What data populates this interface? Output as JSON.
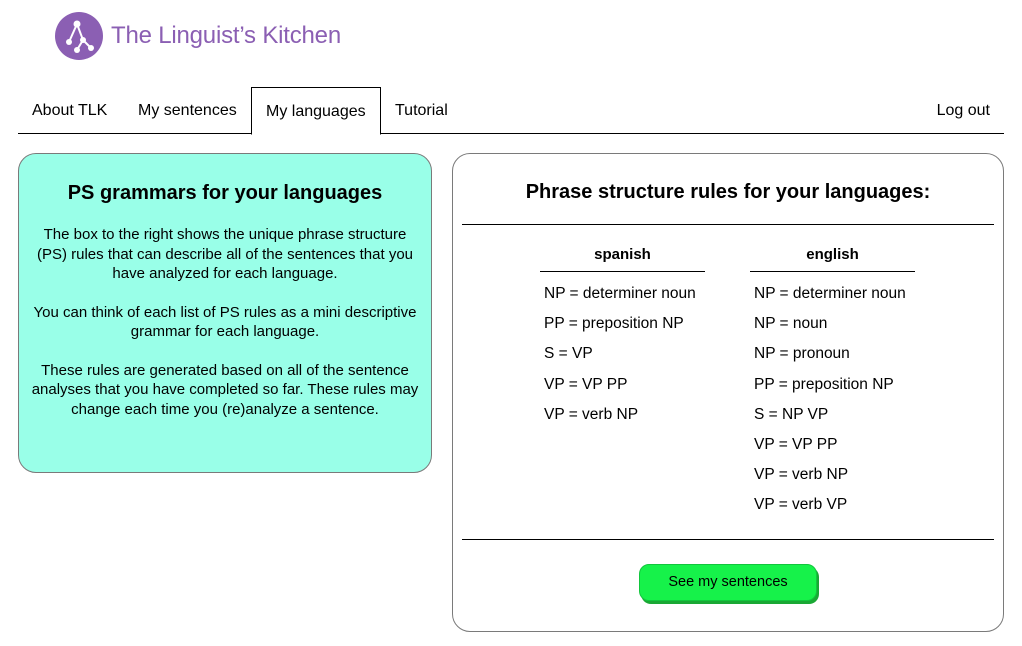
{
  "brand": {
    "name": "The Linguist’s Kitchen",
    "color": "#8b5fb3"
  },
  "nav": {
    "tabs": [
      {
        "label": "About TLK"
      },
      {
        "label": "My sentences"
      },
      {
        "label": "My languages",
        "active": true
      },
      {
        "label": "Tutorial"
      }
    ],
    "logout_label": "Log out"
  },
  "info": {
    "title": "PS grammars for your languages",
    "paragraphs": [
      "The box to the right shows the unique phrase structure (PS) rules that can describe all of the sentences that you have analyzed for each language.",
      "You can think of each list of PS rules as a mini descriptive grammar for each language.",
      "These rules are generated based on all of the sentence analyses that you have completed so far. These rules may change each time you (re)analyze a sentence."
    ],
    "background": "#99ffe8"
  },
  "rules": {
    "title": "Phrase structure rules for your languages:",
    "languages": [
      {
        "name": "spanish",
        "rules": [
          "NP = determiner noun",
          "PP = preposition NP",
          "S = VP",
          "VP = VP PP",
          "VP = verb NP"
        ]
      },
      {
        "name": "english",
        "rules": [
          "NP = determiner noun",
          "NP = noun",
          "NP = pronoun",
          "PP = preposition NP",
          "S = NP VP",
          "VP = VP PP",
          "VP = verb NP",
          "VP = verb VP"
        ]
      }
    ],
    "button_label": "See my sentences",
    "button_color": "#16f24a"
  }
}
